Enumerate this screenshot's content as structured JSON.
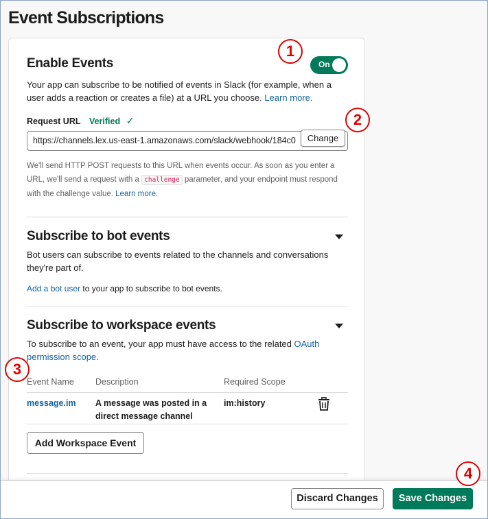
{
  "page": {
    "title": "Event Subscriptions"
  },
  "enable_events": {
    "title": "Enable Events",
    "toggle_label": "On",
    "description": "Your app can subscribe to be notified of events in Slack (for example, when a user adds a reaction or creates a file) at a URL you choose.",
    "learn_more": "Learn more.",
    "request_url_label": "Request URL",
    "verified_label": "Verified",
    "url_value": "https://channels.lex.us-east-1.amazonaws.com/slack/webhook/184c0",
    "change_label": "Change",
    "help_part1": "We'll send HTTP POST requests to this URL when events occur. As soon as you enter a URL, we'll send a request with a",
    "help_code": "challenge",
    "help_part2": "parameter, and your endpoint must respond with the challenge value.",
    "help_learn_more": "Learn more."
  },
  "bot_events": {
    "title": "Subscribe to bot events",
    "description": "Bot users can subscribe to events related to the channels and conversations they're part of.",
    "add_link": "Add a bot user",
    "add_suffix": "to your app to subscribe to bot events."
  },
  "workspace_events": {
    "title": "Subscribe to workspace events",
    "description_prefix": "To subscribe to an event, your app must have access to the related",
    "oauth_link": "OAuth permission scope.",
    "columns": [
      "Event Name",
      "Description",
      "Required Scope"
    ],
    "rows": [
      {
        "name": "message.im",
        "description": "A message was posted in a direct message channel",
        "scope": "im:history"
      }
    ],
    "add_button": "Add Workspace Event"
  },
  "footer": {
    "discard_label": "Discard Changes",
    "save_label": "Save Changes"
  },
  "annotations": [
    "1",
    "2",
    "3",
    "4"
  ],
  "colors": {
    "accent_green": "#007a5a",
    "link_blue": "#1264a3",
    "annotation_red": "#e00000"
  }
}
